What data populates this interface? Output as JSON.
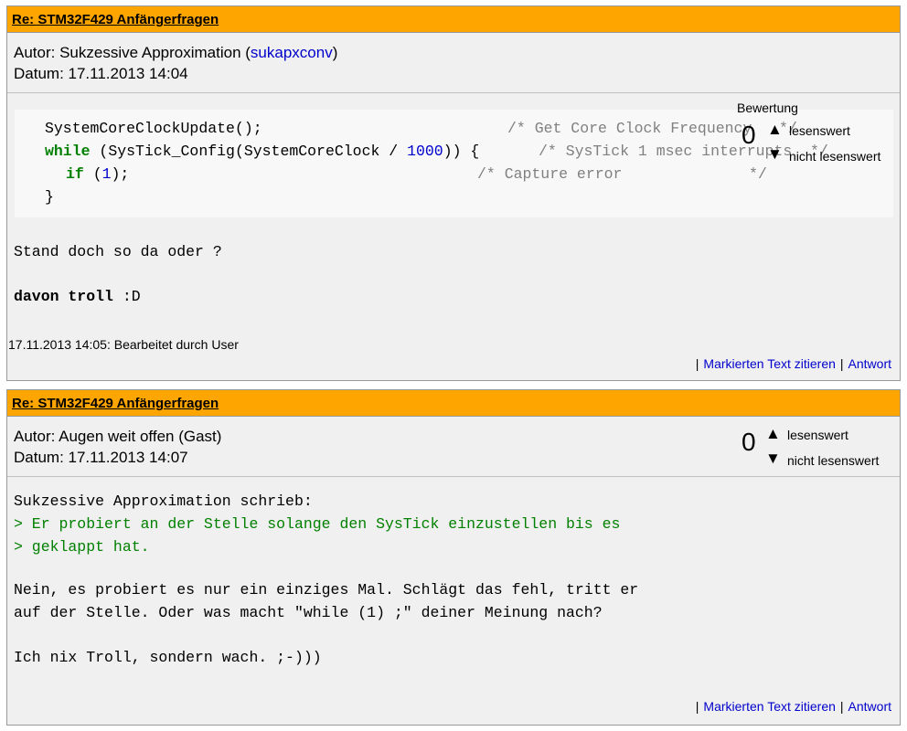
{
  "posts": [
    {
      "title": "Re: STM32F429 Anfängerfragen",
      "author_prefix": "Autor: ",
      "author_name": "Sukzessive Approximation (",
      "author_username": "sukapxconv",
      "author_suffix": ")",
      "date": "Datum: 17.11.2013 14:04",
      "rating": {
        "title": "Bewertung",
        "count": "0",
        "up_label": "lesenswert",
        "down_label": "nicht lesenswert"
      },
      "code_lines": [
        {
          "a": "SystemCoreClockUpdate();",
          "b": "/* Get Core Clock Frequency   */"
        },
        {
          "kw": "while",
          "a": " (SysTick_Config(SystemCoreClock / ",
          "num": "1000",
          "a2": ")) { ",
          "b": "/* SysTick 1 msec interrupts  */"
        },
        {
          "kw": "if",
          "a": " (",
          "num": "1",
          "a2": ");",
          "b": "/* Capture error              */"
        },
        {
          "a": "}"
        }
      ],
      "text_lines": [
        "Stand doch so da oder ?"
      ],
      "bold_text": "davon troll",
      "bold_suffix": " :D",
      "edited": "17.11.2013 14:05: Bearbeitet durch User",
      "actions": {
        "separator": "|",
        "quote": "Markierten Text zitieren",
        "reply": "Antwort"
      }
    },
    {
      "title": "Re: STM32F429 Anfängerfragen",
      "author": "Autor: Augen weit offen (Gast)",
      "date": "Datum: 17.11.2013 14:07",
      "rating": {
        "count": "0",
        "up_label": "lesenswert",
        "down_label": "nicht lesenswert"
      },
      "lines": [
        {
          "type": "plain",
          "text": "Sukzessive Approximation schrieb:"
        },
        {
          "type": "quote",
          "text": "> Er probiert an der Stelle solange den SysTick einzustellen bis es"
        },
        {
          "type": "quote",
          "text": "> geklappt hat."
        },
        {
          "type": "plain",
          "text": "Nein, es probiert es nur ein einziges Mal. Schlägt das fehl, tritt er"
        },
        {
          "type": "plain",
          "text": "auf der Stelle. Oder was macht \"while (1) ;\" deiner Meinung nach?"
        },
        {
          "type": "plain",
          "text": "Ich nix Troll, sondern wach. ;-)))"
        }
      ],
      "actions": {
        "separator": "|",
        "quote": "Markierten Text zitieren",
        "reply": "Antwort"
      }
    }
  ]
}
